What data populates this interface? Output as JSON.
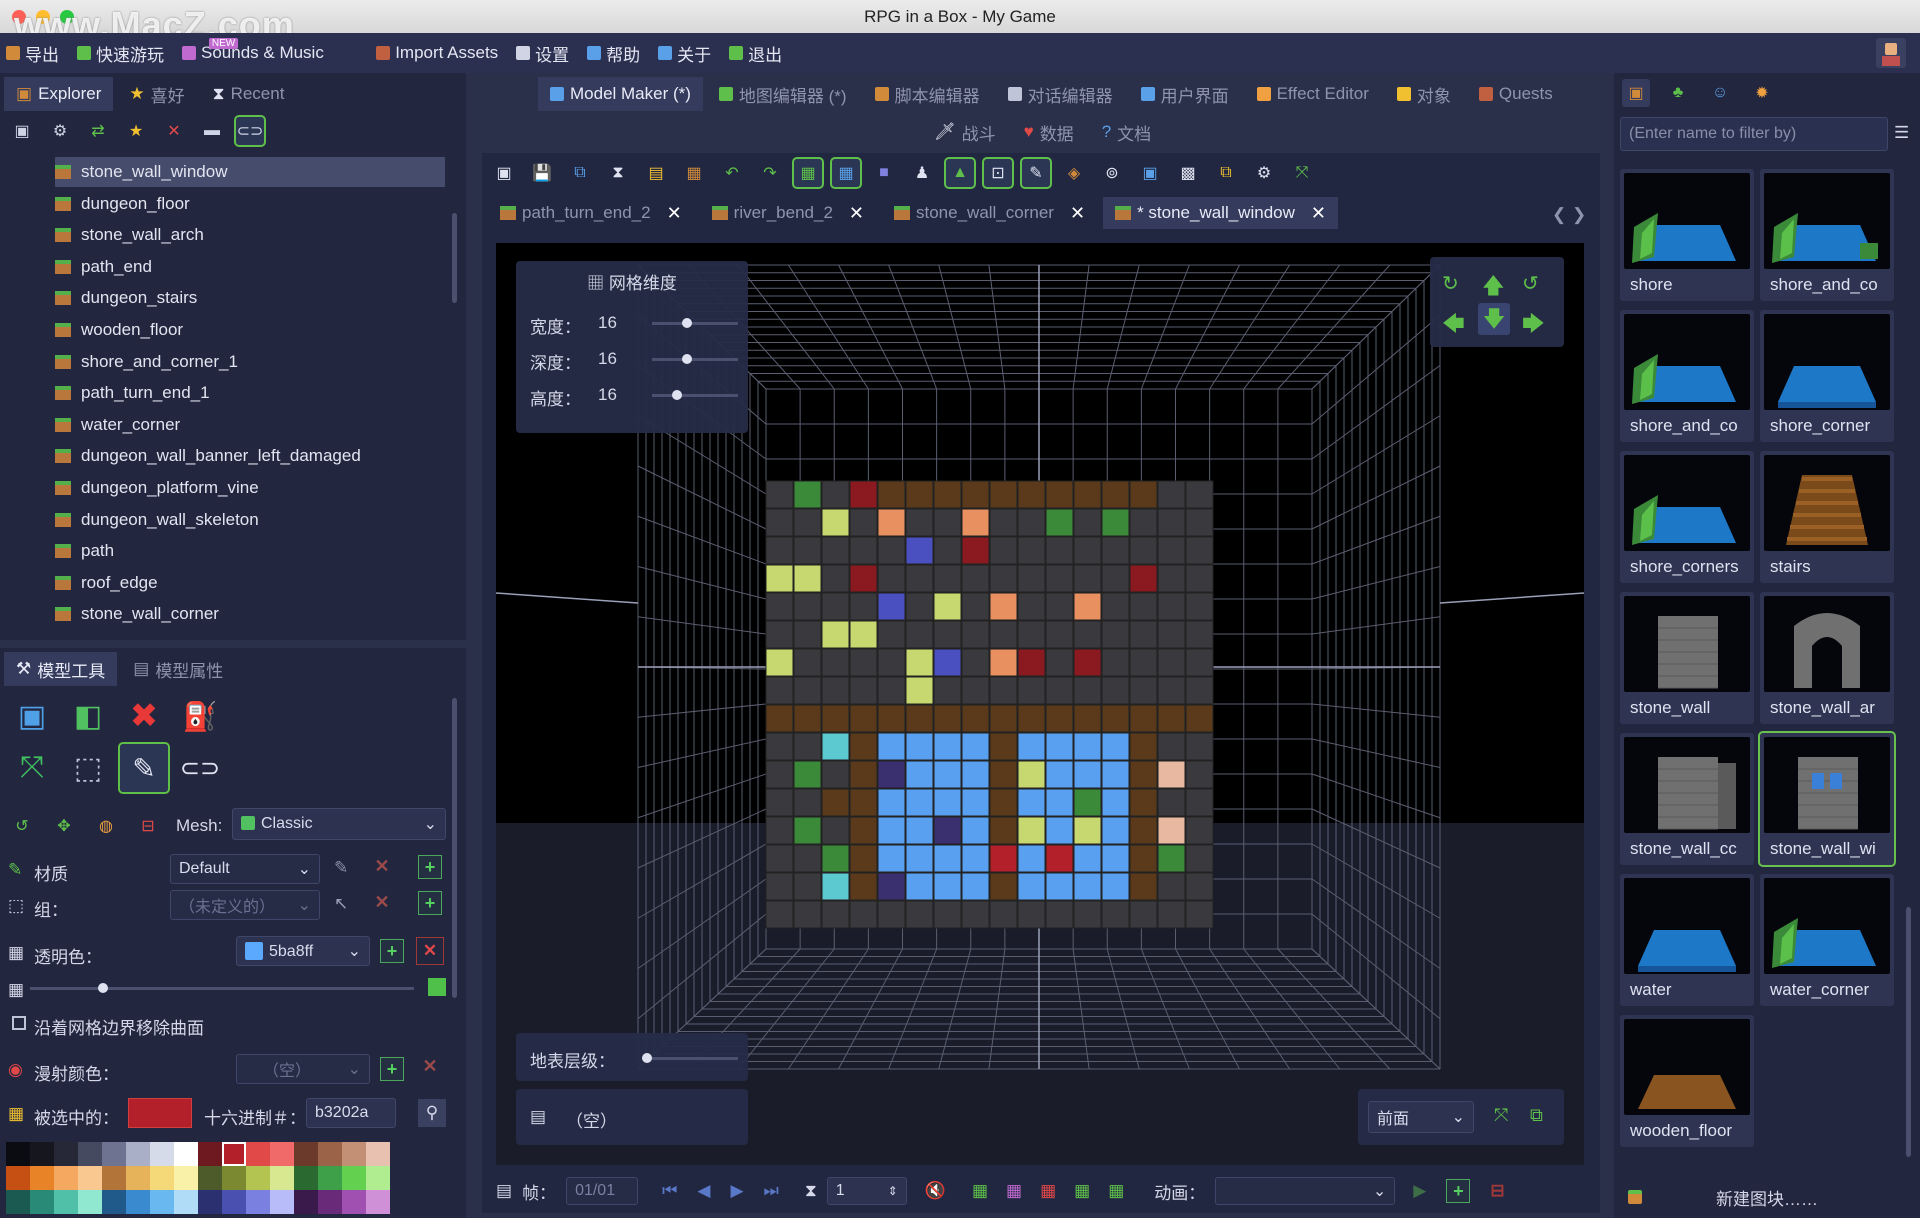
{
  "window": {
    "title": "RPG in a Box - My Game",
    "watermark": "www.MacZ.com"
  },
  "menu": [
    {
      "icon": "export-icon",
      "label": "导出",
      "color": "#d08a3a"
    },
    {
      "icon": "play-icon",
      "label": "快速游玩",
      "color": "#5ec04a"
    },
    {
      "icon": "music-icon",
      "label": "Sounds & Music",
      "color": "#c06ad0",
      "badge": "NEW"
    },
    {
      "icon": "import-icon",
      "label": "Import Assets",
      "color": "#c06040"
    },
    {
      "icon": "settings-icon",
      "label": "设置",
      "color": "#d0d4e4"
    },
    {
      "icon": "help-icon",
      "label": "帮助",
      "color": "#5aa0e8"
    },
    {
      "icon": "info-icon",
      "label": "关于",
      "color": "#5aa0e8"
    },
    {
      "icon": "exit-icon",
      "label": "退出",
      "color": "#5ec04a"
    }
  ],
  "left_tabs": [
    {
      "label": "Explorer",
      "icon": "folder-icon"
    },
    {
      "label": "喜好",
      "icon": "star-icon"
    },
    {
      "label": "Recent",
      "icon": "hourglass-icon"
    }
  ],
  "tree": [
    "stone_wall_window",
    "dungeon_floor",
    "stone_wall_arch",
    "path_end",
    "dungeon_stairs",
    "wooden_floor",
    "shore_and_corner_1",
    "path_turn_end_1",
    "water_corner",
    "dungeon_wall_banner_left_damaged",
    "dungeon_platform_vine",
    "dungeon_wall_skeleton",
    "path",
    "roof_edge",
    "stone_wall_corner"
  ],
  "tool_tabs": [
    {
      "label": "模型工具"
    },
    {
      "label": "模型属性"
    }
  ],
  "mesh": {
    "label": "Mesh:",
    "value": "Classic"
  },
  "material": {
    "label": "材质",
    "value": "Default"
  },
  "group": {
    "label": "组：",
    "value": "（未定义的）"
  },
  "transparent": {
    "label": "透明色：",
    "value": "5ba8ff",
    "swatch": "#5ba8ff"
  },
  "remove_surface": {
    "label": "沿着网格边界移除曲面"
  },
  "diffuse": {
    "label": "漫射颜色：",
    "value": "（空）"
  },
  "selected": {
    "label": "被选中的：",
    "hex_label": "十六进制＃：",
    "hex": "b3202a",
    "swatch": "#b3202a"
  },
  "palette": [
    "#0b0b12",
    "#16161f",
    "#262838",
    "#454a60",
    "#6d7391",
    "#a9afc7",
    "#d6dbea",
    "#ffffff",
    "#6e1820",
    "#b3202a",
    "#e14848",
    "#f06a6a",
    "#6b3a2a",
    "#9b6448",
    "#c39076",
    "#e9c1b0",
    "#c65014",
    "#e88328",
    "#f5a860",
    "#f8c890",
    "#b3743a",
    "#e6b25a",
    "#f5d878",
    "#faf1a8",
    "#4d5a2a",
    "#7b8a30",
    "#b3c550",
    "#d7e890",
    "#2a6a30",
    "#3ea048",
    "#64d050",
    "#b0ec90",
    "#1a5a50",
    "#2a8a78",
    "#50c0a8",
    "#90e8d0",
    "#1f5a8a",
    "#3a8ad0",
    "#6ab8f0",
    "#b0dcf8",
    "#2a3070",
    "#4a50b0",
    "#7a80e0",
    "#b8bcf8",
    "#3a1a4a",
    "#6a2a7a",
    "#a050b0",
    "#d090d8"
  ],
  "editor_tabs": [
    {
      "label": "Model Maker (*)",
      "icon": "model-icon",
      "active": true
    },
    {
      "label": "地图编辑器 (*)",
      "icon": "map-icon"
    },
    {
      "label": "脚本编辑器",
      "icon": "script-icon"
    },
    {
      "label": "对话编辑器",
      "icon": "dialogue-icon"
    },
    {
      "label": "用户界面",
      "icon": "ui-icon"
    },
    {
      "label": "Effect Editor",
      "icon": "effect-icon"
    },
    {
      "label": "对象",
      "icon": "object-icon"
    },
    {
      "label": "Quests",
      "icon": "quest-icon"
    }
  ],
  "editor_tabs2": [
    {
      "label": "战斗",
      "icon": "sword-icon"
    },
    {
      "label": "数据",
      "icon": "heart-icon"
    },
    {
      "label": "文档",
      "icon": "doc-icon"
    }
  ],
  "file_tabs": [
    {
      "label": "path_turn_end_2"
    },
    {
      "label": "river_bend_2"
    },
    {
      "label": "stone_wall_corner"
    },
    {
      "label": "* stone_wall_window",
      "active": true
    }
  ],
  "grid_dims": {
    "title": "网格维度",
    "width_label": "宽度：",
    "width": "16",
    "depth_label": "深度：",
    "depth": "16",
    "height_label": "高度：",
    "height": "16"
  },
  "ground_level": {
    "label": "地表层级："
  },
  "empty_slot": {
    "label": "（空）"
  },
  "view": {
    "value": "前面"
  },
  "bottom_bar": {
    "frame_label": "帧：",
    "frame_value": "01/01",
    "speed_value": "1",
    "anim_label": "动画："
  },
  "right_search": {
    "placeholder": "(Enter name to filter by)"
  },
  "blocks": [
    {
      "label": "shore",
      "kind": "shore"
    },
    {
      "label": "shore_and_co",
      "kind": "shore2"
    },
    {
      "label": "shore_and_co",
      "kind": "shore3"
    },
    {
      "label": "shore_corner",
      "kind": "water"
    },
    {
      "label": "shore_corners",
      "kind": "shore4"
    },
    {
      "label": "stairs",
      "kind": "stairs"
    },
    {
      "label": "stone_wall",
      "kind": "wall"
    },
    {
      "label": "stone_wall_ar",
      "kind": "arch"
    },
    {
      "label": "stone_wall_cc",
      "kind": "wallc"
    },
    {
      "label": "stone_wall_wi",
      "kind": "window",
      "selected": true
    },
    {
      "label": "water",
      "kind": "water"
    },
    {
      "label": "water_corner",
      "kind": "shore3"
    },
    {
      "label": "wooden_floor",
      "kind": "wood"
    }
  ],
  "new_block": {
    "label": "新建图块……"
  },
  "colors": {
    "accent_green": "#5ec04a",
    "bg": "#2a2f4a",
    "panel": "#22273f"
  }
}
